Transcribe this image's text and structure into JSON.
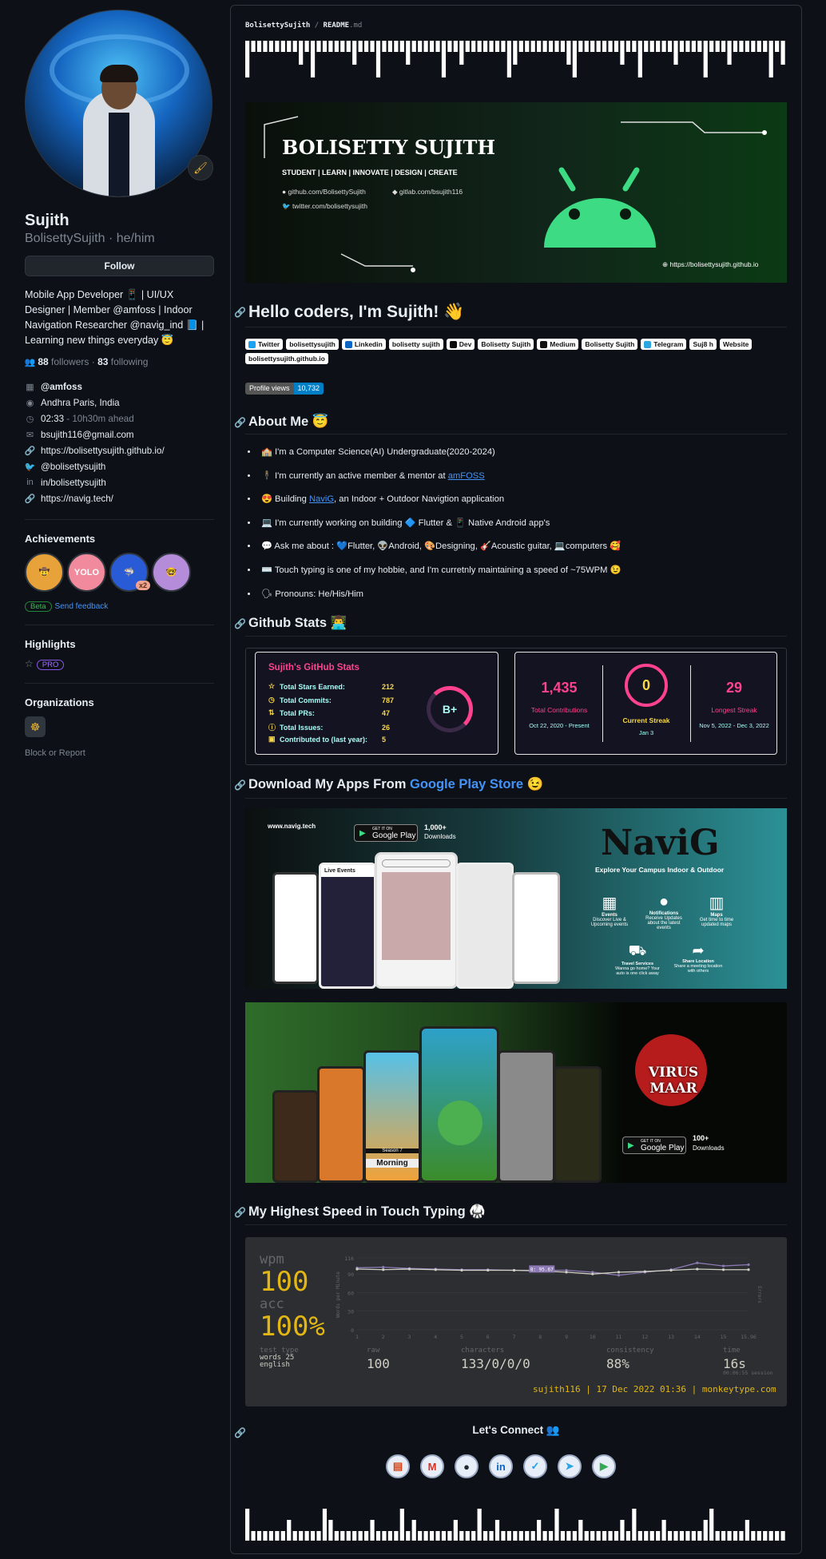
{
  "profile": {
    "name": "Sujith",
    "login_line": "BolisettySujith · he/him",
    "follow_label": "Follow",
    "status_emoji": "🖌",
    "bio_lines": [
      "Mobile App Developer 📱 | UI/UX",
      "Designer | Member @amfoss | Indoor",
      "Navigation Researcher @navig_ind 📘 |",
      "Learning new things everyday 😇"
    ],
    "followers": "88",
    "followers_label": "followers",
    "following": "83",
    "following_label": "following",
    "details": [
      {
        "icon": "org-icon",
        "text": "@amfoss"
      },
      {
        "icon": "location-icon",
        "text": "Andhra Paris, India"
      },
      {
        "icon": "clock-icon",
        "text": "02:33 - 10h30m ahead"
      },
      {
        "icon": "mail-icon",
        "text": "bsujith116@gmail.com"
      },
      {
        "icon": "link-icon",
        "text": "https://bolisettysujith.github.io/"
      },
      {
        "icon": "twitter-icon",
        "text": "@bolisettysujith"
      },
      {
        "icon": "linkedin-icon",
        "text": "in/bolisettysujith"
      },
      {
        "icon": "link-icon",
        "text": "https://navig.tech/"
      }
    ],
    "achievements_title": "Achievements",
    "beta": "Beta",
    "feedback": "Send feedback",
    "highlights_title": "Highlights",
    "pro": "PRO",
    "organizations_title": "Organizations",
    "block": "Block or Report",
    "badge_x2": "x2"
  },
  "readme": {
    "path_user": "BolisettySujith",
    "path_sep": "/",
    "path_file": "README",
    "path_ext": ".md"
  },
  "banner": {
    "name": "BOLISETTY SUJITH",
    "roles": "STUDENT | LEARN | INNOVATE | DESIGN | CREATE",
    "github": "github.com/BolisettySujith",
    "gitlab": "gitlab.com/bsujith116",
    "twitter": "twitter.com/bolisettysujith",
    "site": "https://bolisettysujith.github.io"
  },
  "hello": {
    "title": "Hello coders, I'm Sujith! 👋"
  },
  "tags": [
    {
      "label": "Twitter",
      "color": "#1da1f2"
    },
    {
      "label": "bolisettysujith",
      "color": ""
    },
    {
      "label": "Linkedin",
      "color": "#0a66c2"
    },
    {
      "label": "bolisetty sujith",
      "color": ""
    },
    {
      "label": "Dev",
      "color": "#0a0a0a"
    },
    {
      "label": "Bolisetty Sujith",
      "color": ""
    },
    {
      "label": "Medium",
      "color": "#12100e"
    },
    {
      "label": "Bolisetty Sujith",
      "color": ""
    },
    {
      "label": "Telegram",
      "color": "#2ca5e0"
    },
    {
      "label": "Suj8 h",
      "color": ""
    },
    {
      "label": "Website",
      "color": ""
    },
    {
      "label": "bolisettysujith.github.io",
      "color": ""
    }
  ],
  "views": {
    "label": "Profile views",
    "count": "10,732"
  },
  "about": {
    "title": "About Me 😇",
    "items": [
      "🏫 I'm a Computer Science(AI) Undergraduate(2020-2024)",
      "🕴 I'm currently an active member & mentor at ",
      "😍 Building ",
      "💻 I'm currently working on building 🔷 Flutter & 📱 Native Android app's",
      "💬 Ask me about : 💙Flutter, 👽Android, 🎨Designing, 🎸Acoustic guitar, 💻computers 🥰",
      "⌨️ Touch typing is one of my hobbie, and I'm curretnly maintaining a speed of ~75WPM 😉",
      "🗣 Pronouns: He/His/Him"
    ],
    "amfoss_link": "amFOSS",
    "navig_link": "NaviG",
    "navig_tail": ", an Indoor + Outdoor Navigtion application"
  },
  "stats": {
    "title": "Github Stats 👨‍💻",
    "card_title": "Sujith's GitHub Stats",
    "rows": [
      {
        "icon": "star-icon",
        "label": "Total Stars Earned:",
        "value": "212"
      },
      {
        "icon": "commit-icon",
        "label": "Total Commits:",
        "value": "787"
      },
      {
        "icon": "pr-icon",
        "label": "Total PRs:",
        "value": "47"
      },
      {
        "icon": "issue-icon",
        "label": "Total Issues:",
        "value": "26"
      },
      {
        "icon": "contrib-icon",
        "label": "Contributed to (last year):",
        "value": "5"
      }
    ],
    "grade": "B+",
    "streak": [
      {
        "num": "1,435",
        "label": "Total Contributions",
        "date": "Oct 22, 2020 - Present"
      },
      {
        "num": "0",
        "label": "Current Streak",
        "date": "Jan 3"
      },
      {
        "num": "29",
        "label": "Longest Streak",
        "date": "Nov 5, 2022 - Dec 3, 2022"
      }
    ]
  },
  "apps": {
    "title_a": "Download My Apps From ",
    "title_link": "Google Play Store",
    "title_b": " 😉",
    "navig": {
      "url": "www.navig.tech",
      "downloads": "1,000+",
      "downloads_label": "Downloads",
      "get_it": "GET IT ON",
      "store": "Google Play",
      "tagline": "Explore Your Campus Indoor & Outdoor",
      "brand": "NaviG",
      "live": "Live Events",
      "f1": "Events",
      "f1s": "Discover Live & Upcoming events",
      "f2": "Notifications",
      "f2s": "Receive Updates about the latest events",
      "f3": "Maps",
      "f3s": "Get time to time updated maps",
      "f4": "Travel Services",
      "f4s": "Wanna go home? Your auto is one click away",
      "f5": "Share Location",
      "f5s": "Share a meeting location with others"
    },
    "virus": {
      "brand": "VIRUS MAAR",
      "downloads": "100+",
      "downloads_label": "Downloads",
      "get_it": "GET IT ON",
      "store": "Google Play",
      "morning": "Morning",
      "season": "Season 7"
    }
  },
  "typing": {
    "title": "My Highest Speed in Touch Typing 🥋",
    "wpm_label": "wpm",
    "wpm": "100",
    "acc_label": "acc",
    "acc": "100%",
    "test_type_label": "test type",
    "test_type": "words 25",
    "test_lang": "english",
    "raw_label": "raw",
    "raw": "100",
    "chars_label": "characters",
    "chars": "133/0/0/0",
    "cons_label": "consistency",
    "cons": "88%",
    "time_label": "time",
    "time": "16s",
    "session": "00:06:55 session",
    "footer": "sujith116 | 17 Dec 2022 01:36 | monkeytype.com",
    "y_axis": "Words per Minute",
    "y2_axis": "Errors",
    "tooltip": "8: 95.67",
    "chart_data": {
      "type": "line",
      "x": [
        1,
        2,
        3,
        4,
        5,
        6,
        7,
        8,
        9,
        10,
        11,
        12,
        13,
        14,
        15,
        15.96
      ],
      "ylim": [
        0,
        116
      ],
      "y_ticks": [
        0,
        30,
        60,
        90,
        116
      ],
      "x_ticks": [
        "1",
        "2",
        "3",
        "4",
        "5",
        "6",
        "7",
        "8",
        "9",
        "10",
        "11",
        "12",
        "13",
        "14",
        "15",
        "15.96"
      ],
      "series": [
        {
          "name": "",
          "values": [
            100,
            101,
            99,
            98,
            97,
            97,
            96,
            96,
            96,
            93,
            88,
            93,
            97,
            108,
            103,
            105
          ]
        },
        {
          "name": "",
          "values": [
            98,
            97,
            98,
            97,
            96,
            96,
            96,
            95,
            93,
            90,
            93,
            94,
            96,
            98,
            97,
            97
          ]
        }
      ]
    }
  },
  "connect": {
    "title": "Let's Connect 👥",
    "icons": [
      "portfolio-icon",
      "gmail-icon",
      "github-icon",
      "linkedin-icon",
      "twitter-icon",
      "telegram-icon",
      "playstore-icon"
    ]
  }
}
